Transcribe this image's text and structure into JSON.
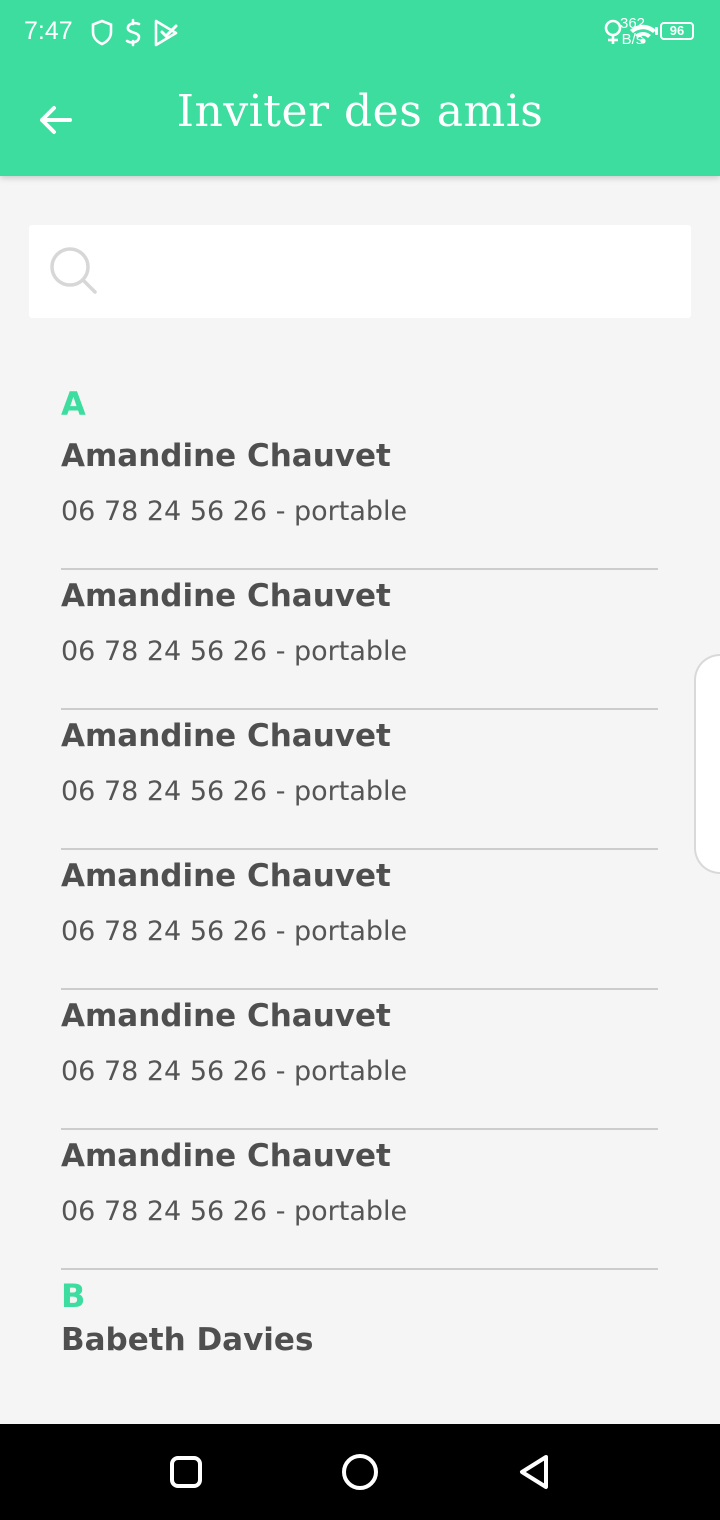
{
  "status_bar": {
    "time": "7:47",
    "net_speed_value": "362",
    "net_speed_unit": "B/s",
    "battery": "96",
    "left_icons": [
      "shield-icon",
      "dollar-icon",
      "play-check-icon"
    ],
    "right_icons": [
      "location-icon",
      "wifi-icon",
      "battery-icon"
    ]
  },
  "app_bar": {
    "title": "Inviter des amis",
    "back_icon": "arrow-left-icon",
    "color": "#3ddc9f"
  },
  "search": {
    "placeholder": "",
    "value": "",
    "icon": "search-icon"
  },
  "sections": [
    {
      "letter": "A",
      "contacts": [
        {
          "name": "Amandine Chauvet",
          "phone": "06 78 24 56 26 - portable"
        },
        {
          "name": "Amandine Chauvet",
          "phone": "06 78 24 56 26 - portable"
        },
        {
          "name": "Amandine Chauvet",
          "phone": "06 78 24 56 26 - portable"
        },
        {
          "name": "Amandine Chauvet",
          "phone": "06 78 24 56 26 - portable"
        },
        {
          "name": "Amandine Chauvet",
          "phone": "06 78 24 56 26 - portable"
        },
        {
          "name": "Amandine Chauvet",
          "phone": "06 78 24 56 26 - portable"
        }
      ]
    },
    {
      "letter": "B",
      "contacts": [
        {
          "name": "Babeth Davies",
          "phone": ""
        }
      ]
    }
  ],
  "colors": {
    "accent": "#3ddc9f",
    "background": "#f5f5f5",
    "text": "#4f4f4f"
  },
  "nav_bar": {
    "buttons": [
      "recents-square-icon",
      "home-circle-icon",
      "back-triangle-icon"
    ]
  }
}
